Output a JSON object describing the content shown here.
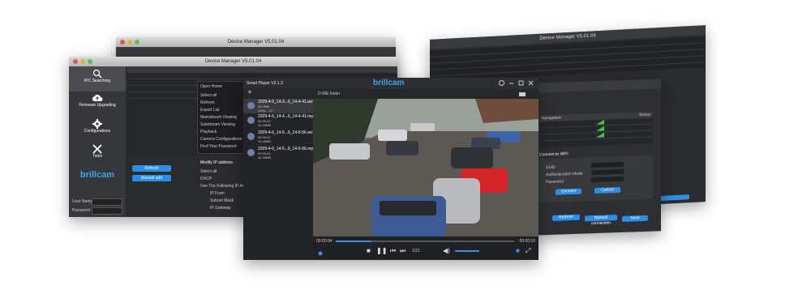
{
  "back_window": {
    "title": "Device Manager V5.01.04"
  },
  "left_window": {
    "title": "Device Manager V5.01.04",
    "sidebar": [
      {
        "label": "IPC Searching",
        "icon": "search-icon"
      },
      {
        "label": "Firmware Upgrading",
        "icon": "cloud-upload-icon"
      },
      {
        "label": "Configurations",
        "icon": "gear-icon"
      },
      {
        "label": "Tools",
        "icon": "tools-icon"
      }
    ],
    "brand": "brillcam",
    "user_name_label": "User Name",
    "password_label": "Password",
    "refresh_label": "Refresh",
    "manual_add_label": "Manual add",
    "context_menu": [
      "Open Home",
      "Select all",
      "Refresh",
      "Export List",
      "Mainstream Viewing",
      "Substream Viewing",
      "Playback",
      "Camera Configurations",
      "Find Your Password"
    ],
    "modify_ip": {
      "title": "Modify IP address",
      "select_all": "Select all",
      "dhcp": "DHCP",
      "use_following": "Use The Following IP Address",
      "ip_from": "IP From",
      "subnet_mask": "Subnet Mask",
      "ip_gateway": "IP Gateway"
    }
  },
  "player": {
    "title": "Smart Player V2.1.3",
    "brand": "brillcam",
    "add_icon": "plus-icon",
    "folder_label": "D:\\RE folder",
    "files": [
      {
        "name": "2029-4-6_14-3...6_14-4-41.avi",
        "size": "44.0MB",
        "date": "2025-...12 ~"
      },
      {
        "name": "2029-4-6_14-4...6_14-4-41.mp4",
        "size": "00.00:42",
        "date": "41.33MB"
      },
      {
        "name": "2029-4-6_14-5...6_14-5-56.avi",
        "size": "00.00:42",
        "date": "41.45MB"
      },
      {
        "name": "2029-4-6_14-5...6_14-5-56.mp4",
        "size": "00.00:42",
        "date": "41.33MB"
      }
    ],
    "time_current": "00:00:04",
    "time_total": "00:00:16",
    "page": "1/21"
  },
  "right_back_window": {
    "title": "Device Manager V5.01.04"
  },
  "right_front_window": {
    "connect_label": "Connect to WiFi",
    "ssid_label": "SSID",
    "auth_label": "Authentication Mode",
    "password_label": "Password",
    "connect_btn": "Connect",
    "cancel_btn": "Cancel",
    "refresh_btn": "Refresh",
    "manual_btn": "Manual connection",
    "save_btn": "Save",
    "navigation_label": "Navigation",
    "status_label": "Status"
  }
}
